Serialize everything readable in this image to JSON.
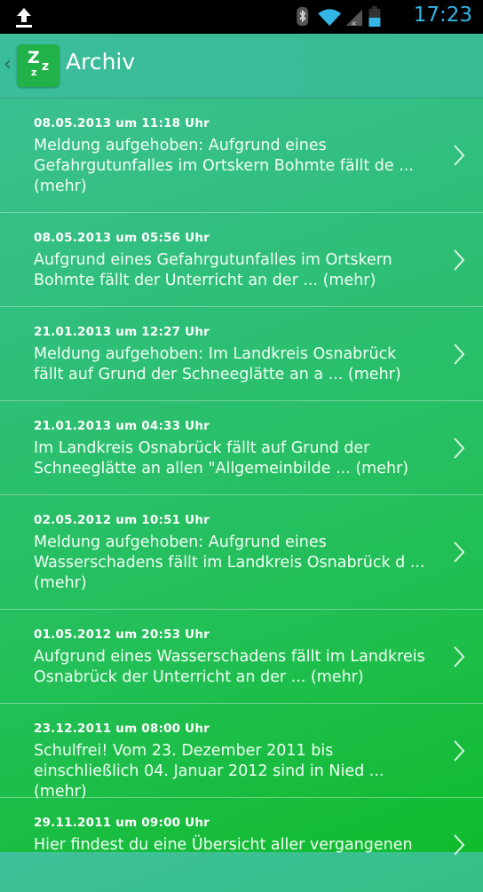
{
  "status": {
    "time": "17:23"
  },
  "header": {
    "title": "Archiv",
    "icon_text": "Zzz"
  },
  "items": [
    {
      "date": "08.05.2013 um 11:18 Uhr",
      "text": "Meldung aufgehoben: Aufgrund eines Gefahrgutunfalles im Ortskern Bohmte fällt de ... (mehr)"
    },
    {
      "date": "08.05.2013 um 05:56 Uhr",
      "text": "Aufgrund eines Gefahrgutunfalles im Ortskern Bohmte fällt der Unterricht an der  ... (mehr)"
    },
    {
      "date": "21.01.2013 um 12:27 Uhr",
      "text": "Meldung aufgehoben: Im Landkreis Osnabrück fällt auf Grund der Schneeglätte an a ... (mehr)"
    },
    {
      "date": "21.01.2013 um 04:33 Uhr",
      "text": "Im Landkreis Osnabrück fällt auf Grund der Schneeglätte an allen \"Allgemeinbilde ... (mehr)"
    },
    {
      "date": "02.05.2012 um 10:51 Uhr",
      "text": "Meldung aufgehoben: Aufgrund eines Wasserschadens fällt im Landkreis Osnabrück d ... (mehr)"
    },
    {
      "date": "01.05.2012 um 20:53 Uhr",
      "text": "Aufgrund eines Wasserschadens fällt im Landkreis Osnabrück der Unterricht an der ... (mehr)"
    },
    {
      "date": "23.12.2011 um 08:00 Uhr",
      "text": "Schulfrei! Vom 23. Dezember 2011 bis einschließlich 04. Januar 2012 sind in Nied ... (mehr)"
    },
    {
      "date": "29.11.2011 um 09:00 Uhr",
      "text": "Hier findest du eine Übersicht aller vergangenen"
    }
  ]
}
